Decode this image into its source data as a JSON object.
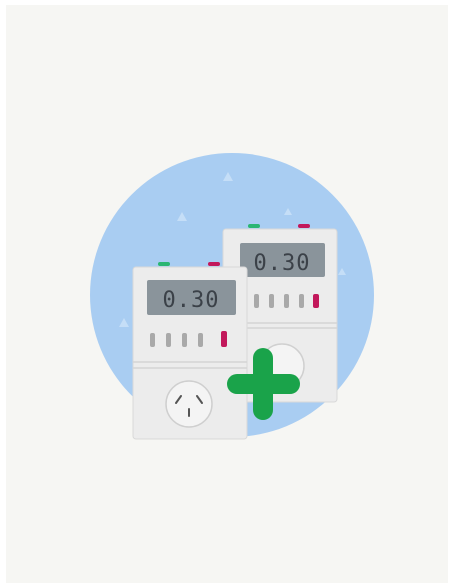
{
  "illustration": {
    "timer_back": {
      "display": "0.30"
    },
    "timer_front": {
      "display": "0.30"
    },
    "icons": [
      "plug-timer-icon",
      "plug-timer-icon",
      "plus-icon",
      "power-socket-icon"
    ],
    "colors": {
      "circle": "#a9cdf2",
      "card_background": "#f6f6f3",
      "device_body": "#ececec",
      "lcd": "#8a949b",
      "indicator_green": "#2bb673",
      "indicator_magenta": "#c2185b",
      "plus": "#1aa34a"
    }
  }
}
